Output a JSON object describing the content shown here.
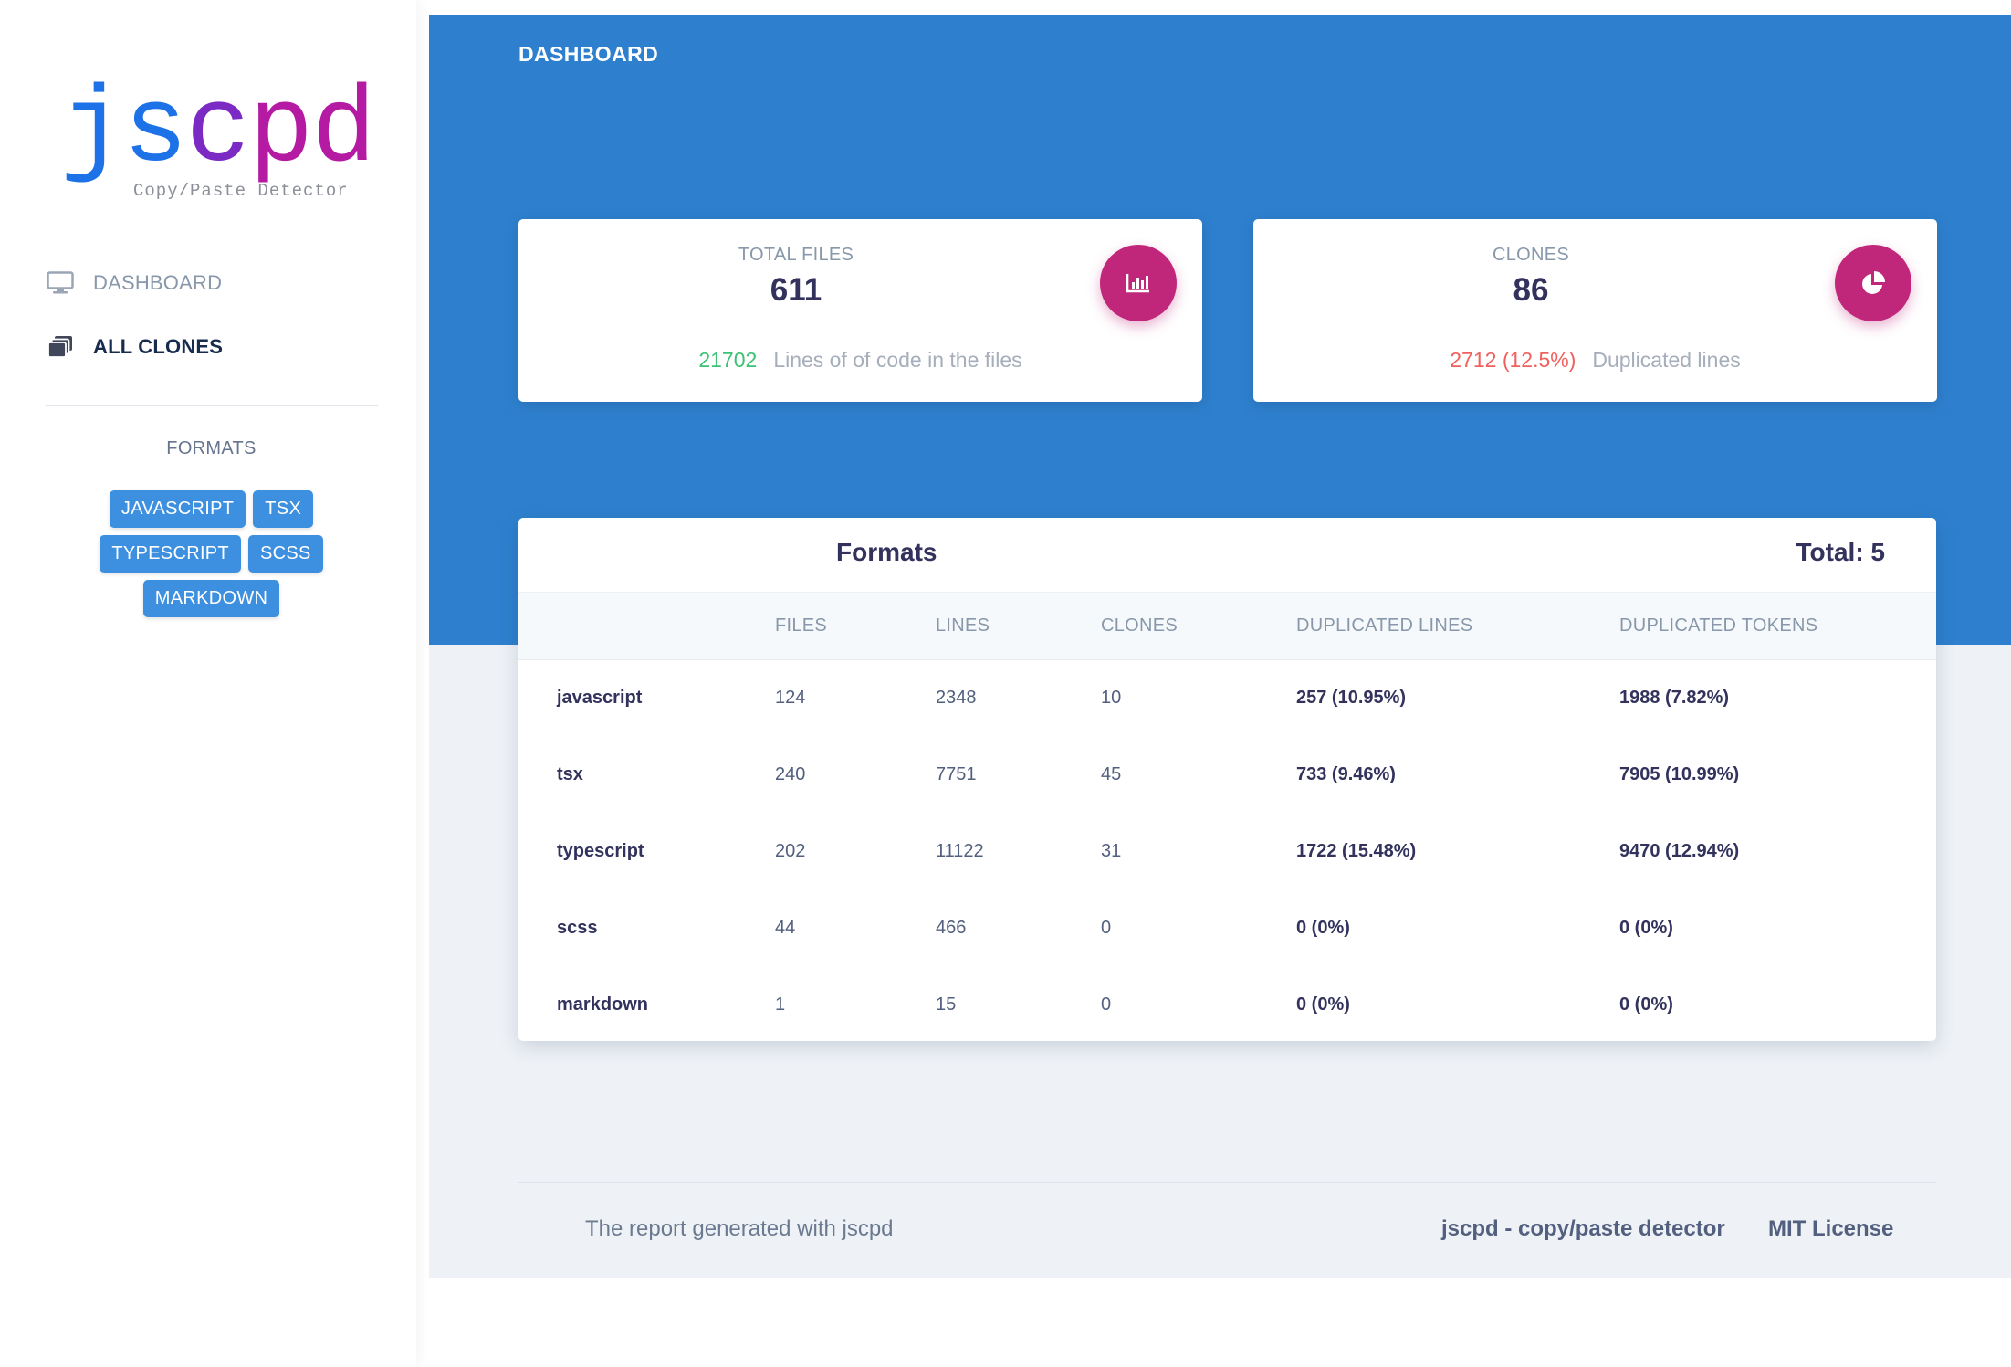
{
  "brand": {
    "logo_letters": [
      "j",
      "s",
      "c",
      "p",
      "d"
    ],
    "tagline": "Copy/Paste Detector",
    "colors": {
      "blue": "#1d72e8",
      "purple": "#7b2bc4",
      "magenta": "#b51aa3"
    }
  },
  "sidebar": {
    "nav": [
      {
        "label": "DASHBOARD",
        "icon": "monitor-icon",
        "active": false
      },
      {
        "label": "ALL CLONES",
        "icon": "clones-stack-icon",
        "active": true
      }
    ],
    "formats_heading": "FORMATS",
    "format_badges": [
      "JAVASCRIPT",
      "TSX",
      "TYPESCRIPT",
      "SCSS",
      "MARKDOWN"
    ]
  },
  "header": {
    "title": "DASHBOARD",
    "band_color": "#2e80ce"
  },
  "stats": {
    "total_files": {
      "label": "TOTAL FILES",
      "value": "611",
      "highlight": "21702",
      "description": "Lines of of code in the files",
      "icon": "bar-chart-icon"
    },
    "clones": {
      "label": "CLONES",
      "value": "86",
      "highlight": "2712 (12.5%)",
      "description": "Duplicated lines",
      "icon": "pie-chart-icon"
    },
    "icon_color": "#c0277a"
  },
  "formats_table": {
    "title": "Formats",
    "total": "Total: 5",
    "columns": [
      "",
      "FILES",
      "LINES",
      "CLONES",
      "DUPLICATED LINES",
      "DUPLICATED TOKENS"
    ],
    "rows": [
      [
        "javascript",
        "124",
        "2348",
        "10",
        "257 (10.95%)",
        "1988 (7.82%)"
      ],
      [
        "tsx",
        "240",
        "7751",
        "45",
        "733 (9.46%)",
        "7905 (10.99%)"
      ],
      [
        "typescript",
        "202",
        "11122",
        "31",
        "1722 (15.48%)",
        "9470 (12.94%)"
      ],
      [
        "scss",
        "44",
        "466",
        "0",
        "0 (0%)",
        "0 (0%)"
      ],
      [
        "markdown",
        "1",
        "15",
        "0",
        "0 (0%)",
        "0 (0%)"
      ]
    ]
  },
  "footer": {
    "note": "The report generated with jscpd",
    "link_project": "jscpd - copy/paste detector",
    "link_license": "MIT License"
  }
}
